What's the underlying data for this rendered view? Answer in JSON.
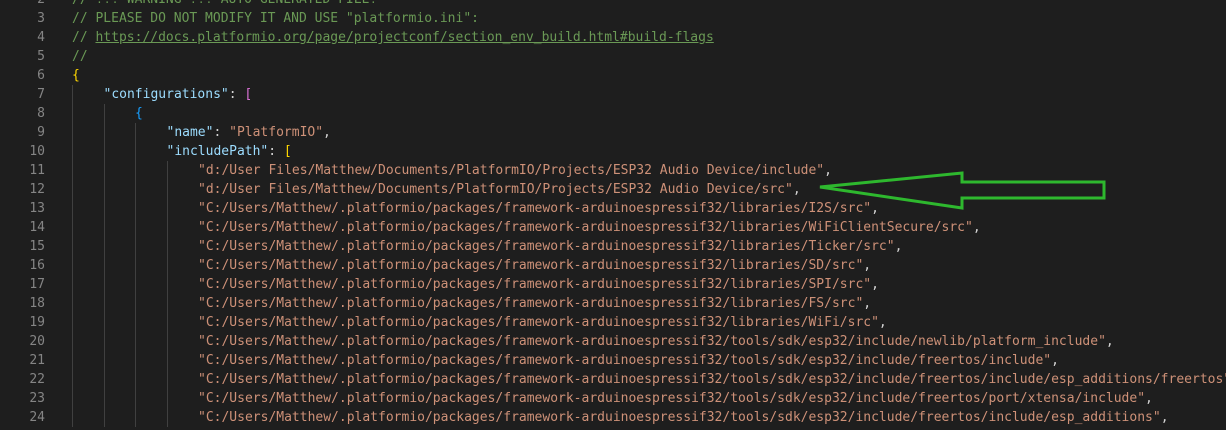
{
  "lines": [
    {
      "n": "2",
      "indent": 0,
      "parts": [
        {
          "t": "// !!! WARNING !!! AUTO-GENERATED FILE!",
          "c": "comment"
        }
      ]
    },
    {
      "n": "3",
      "indent": 0,
      "parts": [
        {
          "t": "// PLEASE DO NOT MODIFY IT AND USE \"platformio.ini\":",
          "c": "comment"
        }
      ]
    },
    {
      "n": "4",
      "indent": 0,
      "parts": [
        {
          "t": "// ",
          "c": "comment"
        },
        {
          "t": "https://docs.platformio.org/page/projectconf/section_env_build.html#build-flags",
          "c": "link"
        }
      ]
    },
    {
      "n": "5",
      "indent": 0,
      "parts": [
        {
          "t": "//",
          "c": "comment"
        }
      ]
    },
    {
      "n": "6",
      "indent": 0,
      "parts": [
        {
          "t": "{",
          "c": "b1"
        }
      ]
    },
    {
      "n": "7",
      "indent": 1,
      "parts": [
        {
          "t": "\"configurations\"",
          "c": "key"
        },
        {
          "t": ": ",
          "c": "punc"
        },
        {
          "t": "[",
          "c": "b2"
        }
      ]
    },
    {
      "n": "8",
      "indent": 2,
      "parts": [
        {
          "t": "{",
          "c": "b3"
        }
      ]
    },
    {
      "n": "9",
      "indent": 3,
      "parts": [
        {
          "t": "\"name\"",
          "c": "key"
        },
        {
          "t": ": ",
          "c": "punc"
        },
        {
          "t": "\"PlatformIO\"",
          "c": "str"
        },
        {
          "t": ",",
          "c": "punc"
        }
      ]
    },
    {
      "n": "10",
      "indent": 3,
      "parts": [
        {
          "t": "\"includePath\"",
          "c": "key"
        },
        {
          "t": ": ",
          "c": "punc"
        },
        {
          "t": "[",
          "c": "b1"
        }
      ]
    },
    {
      "n": "11",
      "indent": 4,
      "parts": [
        {
          "t": "\"d:/User Files/Matthew/Documents/PlatformIO/Projects/ESP32 Audio Device/include\"",
          "c": "str"
        },
        {
          "t": ",",
          "c": "punc"
        }
      ]
    },
    {
      "n": "12",
      "indent": 4,
      "parts": [
        {
          "t": "\"d:/User Files/Matthew/Documents/PlatformIO/Projects/ESP32 Audio Device/src\"",
          "c": "str"
        },
        {
          "t": ",",
          "c": "punc"
        }
      ]
    },
    {
      "n": "13",
      "indent": 4,
      "parts": [
        {
          "t": "\"C:/Users/Matthew/.platformio/packages/framework-arduinoespressif32/libraries/I2S/src\"",
          "c": "str"
        },
        {
          "t": ",",
          "c": "punc"
        }
      ]
    },
    {
      "n": "14",
      "indent": 4,
      "parts": [
        {
          "t": "\"C:/Users/Matthew/.platformio/packages/framework-arduinoespressif32/libraries/WiFiClientSecure/src\"",
          "c": "str"
        },
        {
          "t": ",",
          "c": "punc"
        }
      ]
    },
    {
      "n": "15",
      "indent": 4,
      "parts": [
        {
          "t": "\"C:/Users/Matthew/.platformio/packages/framework-arduinoespressif32/libraries/Ticker/src\"",
          "c": "str"
        },
        {
          "t": ",",
          "c": "punc"
        }
      ]
    },
    {
      "n": "16",
      "indent": 4,
      "parts": [
        {
          "t": "\"C:/Users/Matthew/.platformio/packages/framework-arduinoespressif32/libraries/SD/src\"",
          "c": "str"
        },
        {
          "t": ",",
          "c": "punc"
        }
      ]
    },
    {
      "n": "17",
      "indent": 4,
      "parts": [
        {
          "t": "\"C:/Users/Matthew/.platformio/packages/framework-arduinoespressif32/libraries/SPI/src\"",
          "c": "str"
        },
        {
          "t": ",",
          "c": "punc"
        }
      ]
    },
    {
      "n": "18",
      "indent": 4,
      "parts": [
        {
          "t": "\"C:/Users/Matthew/.platformio/packages/framework-arduinoespressif32/libraries/FS/src\"",
          "c": "str"
        },
        {
          "t": ",",
          "c": "punc"
        }
      ]
    },
    {
      "n": "19",
      "indent": 4,
      "parts": [
        {
          "t": "\"C:/Users/Matthew/.platformio/packages/framework-arduinoespressif32/libraries/WiFi/src\"",
          "c": "str"
        },
        {
          "t": ",",
          "c": "punc"
        }
      ]
    },
    {
      "n": "20",
      "indent": 4,
      "parts": [
        {
          "t": "\"C:/Users/Matthew/.platformio/packages/framework-arduinoespressif32/tools/sdk/esp32/include/newlib/platform_include\"",
          "c": "str"
        },
        {
          "t": ",",
          "c": "punc"
        }
      ]
    },
    {
      "n": "21",
      "indent": 4,
      "parts": [
        {
          "t": "\"C:/Users/Matthew/.platformio/packages/framework-arduinoespressif32/tools/sdk/esp32/include/freertos/include\"",
          "c": "str"
        },
        {
          "t": ",",
          "c": "punc"
        }
      ]
    },
    {
      "n": "22",
      "indent": 4,
      "parts": [
        {
          "t": "\"C:/Users/Matthew/.platformio/packages/framework-arduinoespressif32/tools/sdk/esp32/include/freertos/include/esp_additions/freertos\"",
          "c": "str"
        },
        {
          "t": ",",
          "c": "punc"
        }
      ]
    },
    {
      "n": "23",
      "indent": 4,
      "parts": [
        {
          "t": "\"C:/Users/Matthew/.platformio/packages/framework-arduinoespressif32/tools/sdk/esp32/include/freertos/port/xtensa/include\"",
          "c": "str"
        },
        {
          "t": ",",
          "c": "punc"
        }
      ]
    },
    {
      "n": "24",
      "indent": 4,
      "parts": [
        {
          "t": "\"C:/Users/Matthew/.platformio/packages/framework-arduinoespressif32/tools/sdk/esp32/include/freertos/include/esp_additions\"",
          "c": "str"
        },
        {
          "t": ",",
          "c": "punc"
        }
      ]
    }
  ],
  "colors": {
    "background": "#1e1e1e",
    "line_number": "#858585",
    "comment": "#6a9955",
    "key": "#9cdcfe",
    "string": "#ce9178",
    "annotation_arrow": "#2eb82e"
  },
  "annotation": {
    "icon": "left-arrow-icon",
    "points_to_line": "12"
  }
}
